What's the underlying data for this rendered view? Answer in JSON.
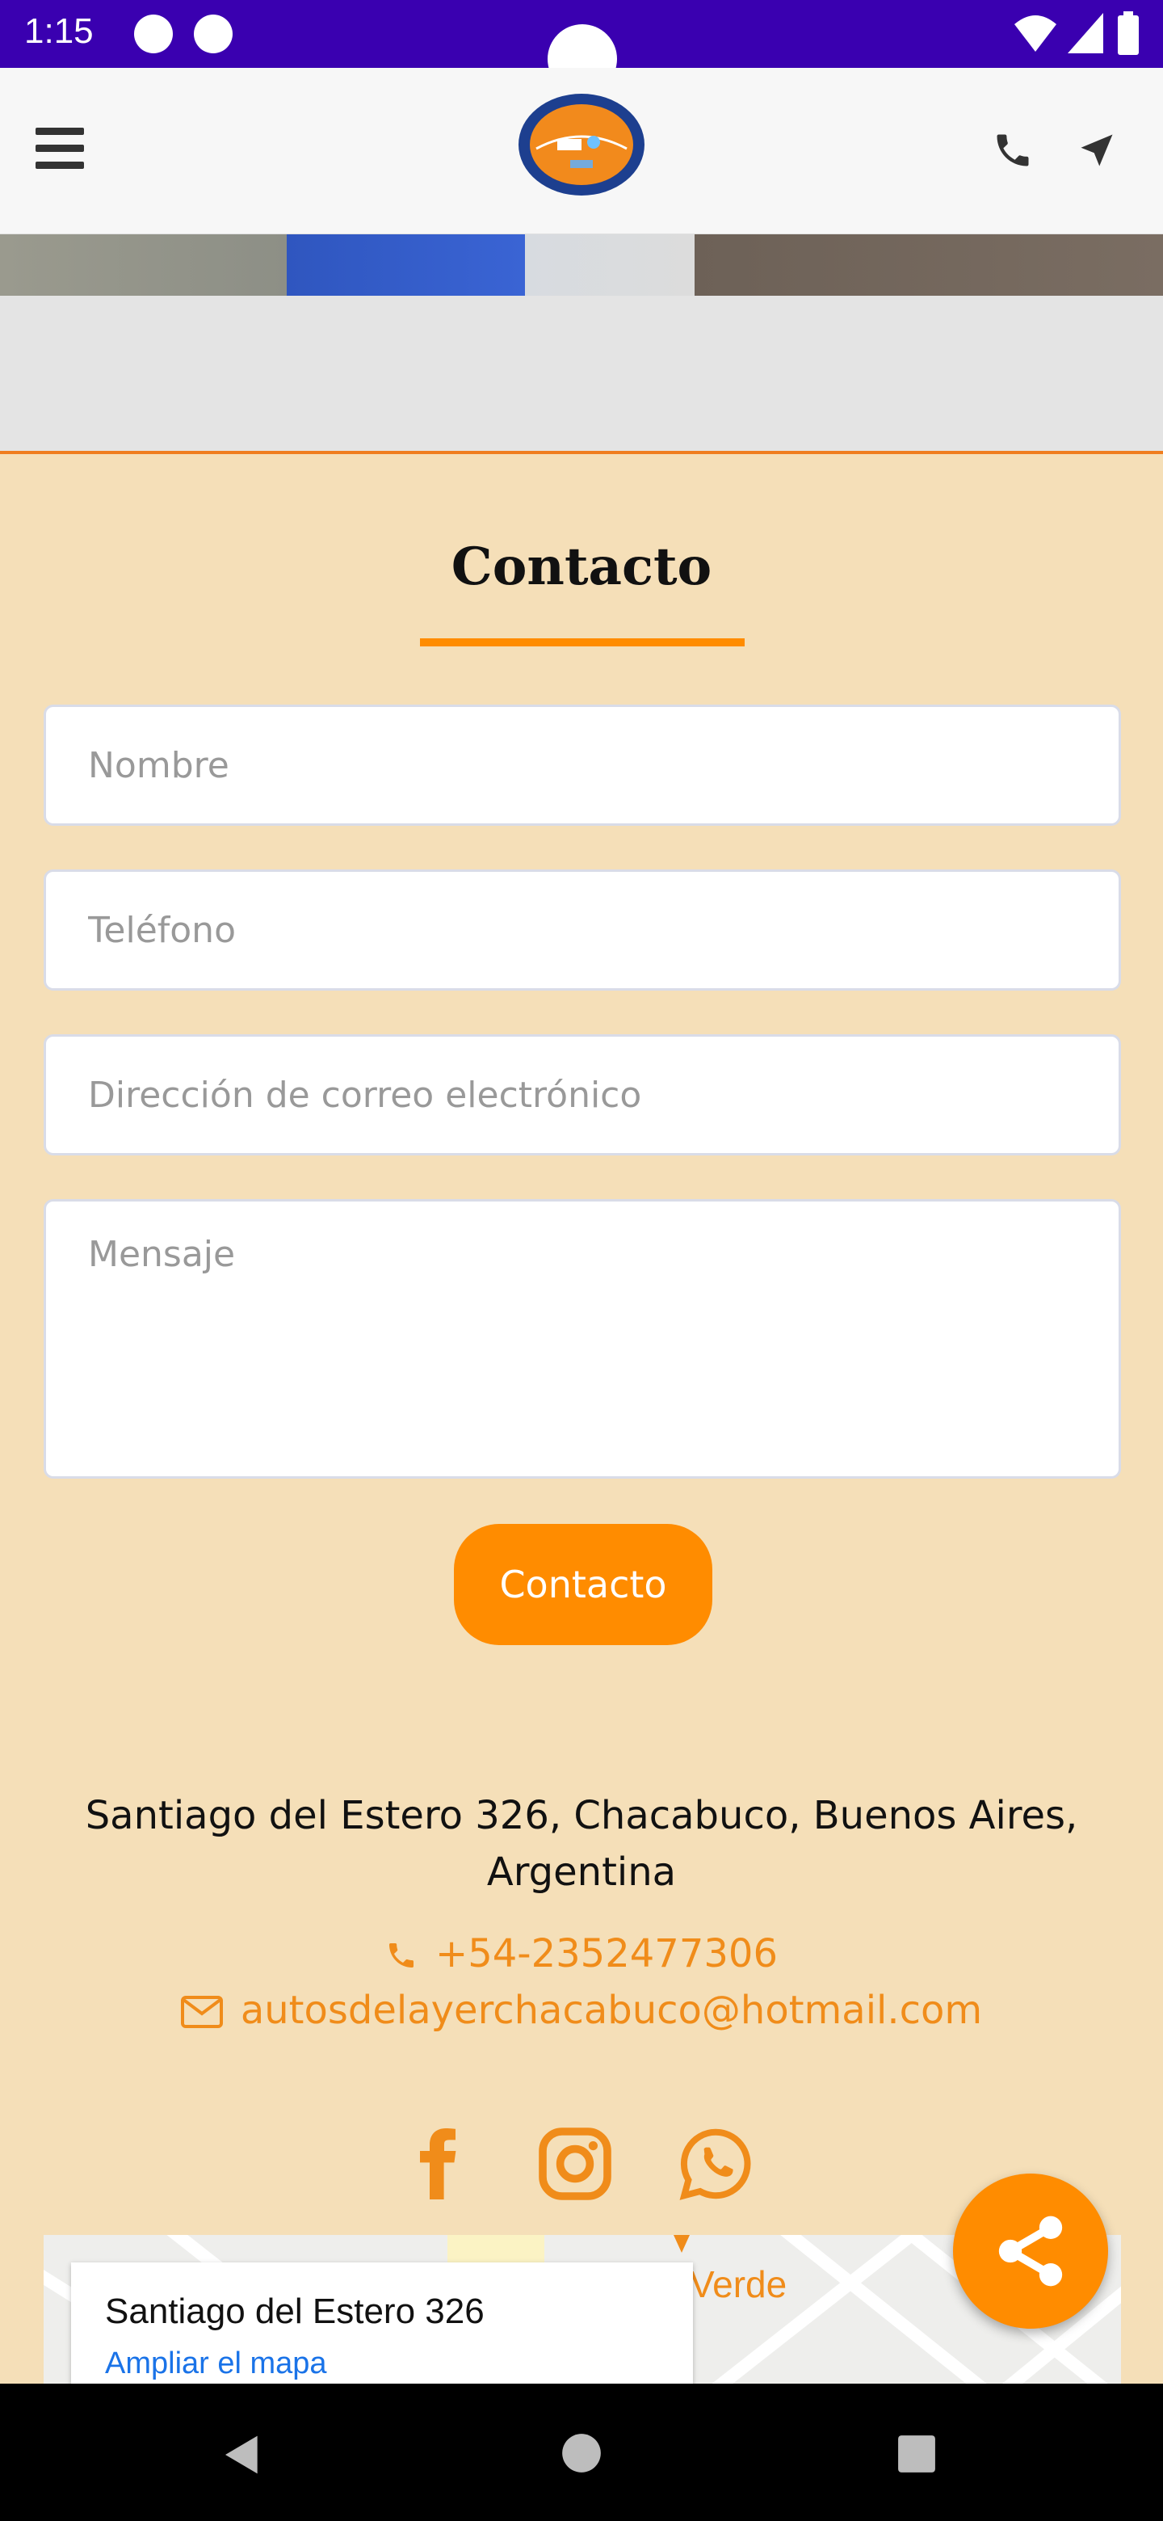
{
  "status_bar": {
    "time": "1:15"
  },
  "header": {
    "menu_icon": "hamburger-icon",
    "logo_alt": "Club Autos del Ayer de Chacabuco logo",
    "phone_icon": "phone-icon",
    "nav_icon": "navigation-arrow-icon"
  },
  "contact": {
    "title": "Contacto",
    "fields": {
      "nombre_placeholder": "Nombre",
      "telefono_placeholder": "Teléfono",
      "email_placeholder": "Dirección de correo electrónico",
      "mensaje_placeholder": "Mensaje"
    },
    "submit_label": "Contacto"
  },
  "info": {
    "address_line1": "Santiago del Estero 326, Chacabuco, Buenos Aires,",
    "address_line2": "Argentina",
    "phone": "+54-2352477306",
    "email": "autosdelayerchacabuco@hotmail.com"
  },
  "social": [
    "facebook-icon",
    "instagram-icon",
    "whatsapp-icon"
  ],
  "map": {
    "place": "Santiago del Estero 326",
    "link": "Ampliar el mapa",
    "label_verde": "Verde"
  },
  "colors": {
    "accent": "#ff8c00",
    "background": "#f5dfb8",
    "statusbar": "#3a00b0",
    "link": "#1a73e8"
  }
}
